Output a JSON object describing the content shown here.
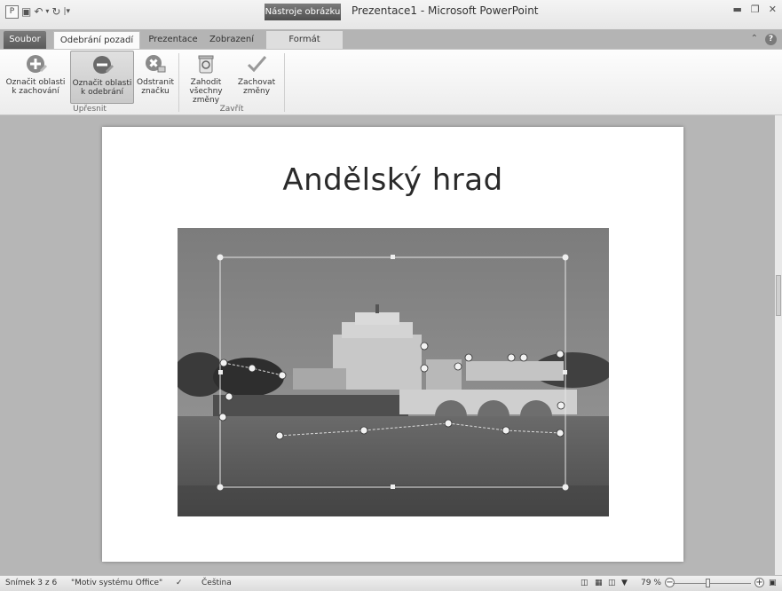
{
  "titlebar": {
    "window_title": "Prezentace1 - Microsoft PowerPoint",
    "context_title": "Nástroje obrázku",
    "qat_icons": [
      "app-icon",
      "save-icon",
      "undo-icon",
      "redo-icon",
      "customize-icon"
    ]
  },
  "tabs": {
    "file": "Soubor",
    "background_removal": "Odebrání pozadí",
    "presentation": "Prezentace",
    "view": "Zobrazení",
    "format": "Formát"
  },
  "ribbon": {
    "mark_keep": {
      "line1": "Označit oblasti",
      "line2": "k zachování"
    },
    "mark_remove": {
      "line1": "Označit oblasti",
      "line2": "k odebrání"
    },
    "delete_mark": {
      "line1": "Odstranit",
      "line2": "značku"
    },
    "discard": {
      "line1": "Zahodit",
      "line2": "všechny změny"
    },
    "keep_changes": {
      "line1": "Zachovat",
      "line2": "změny"
    },
    "group_refine": "Upřesnit",
    "group_close": "Zavřít"
  },
  "slide": {
    "title": "Andělský hrad"
  },
  "statusbar": {
    "slide_count": "Snímek 3 z 6",
    "theme": "\"Motiv systému Office\"",
    "language": "Čeština",
    "zoom": "79 %"
  },
  "colors": {
    "accent_dark": "#5a5a5a",
    "ribbon_bg": "#f2f2f2",
    "workspace": "#b6b6b6"
  }
}
